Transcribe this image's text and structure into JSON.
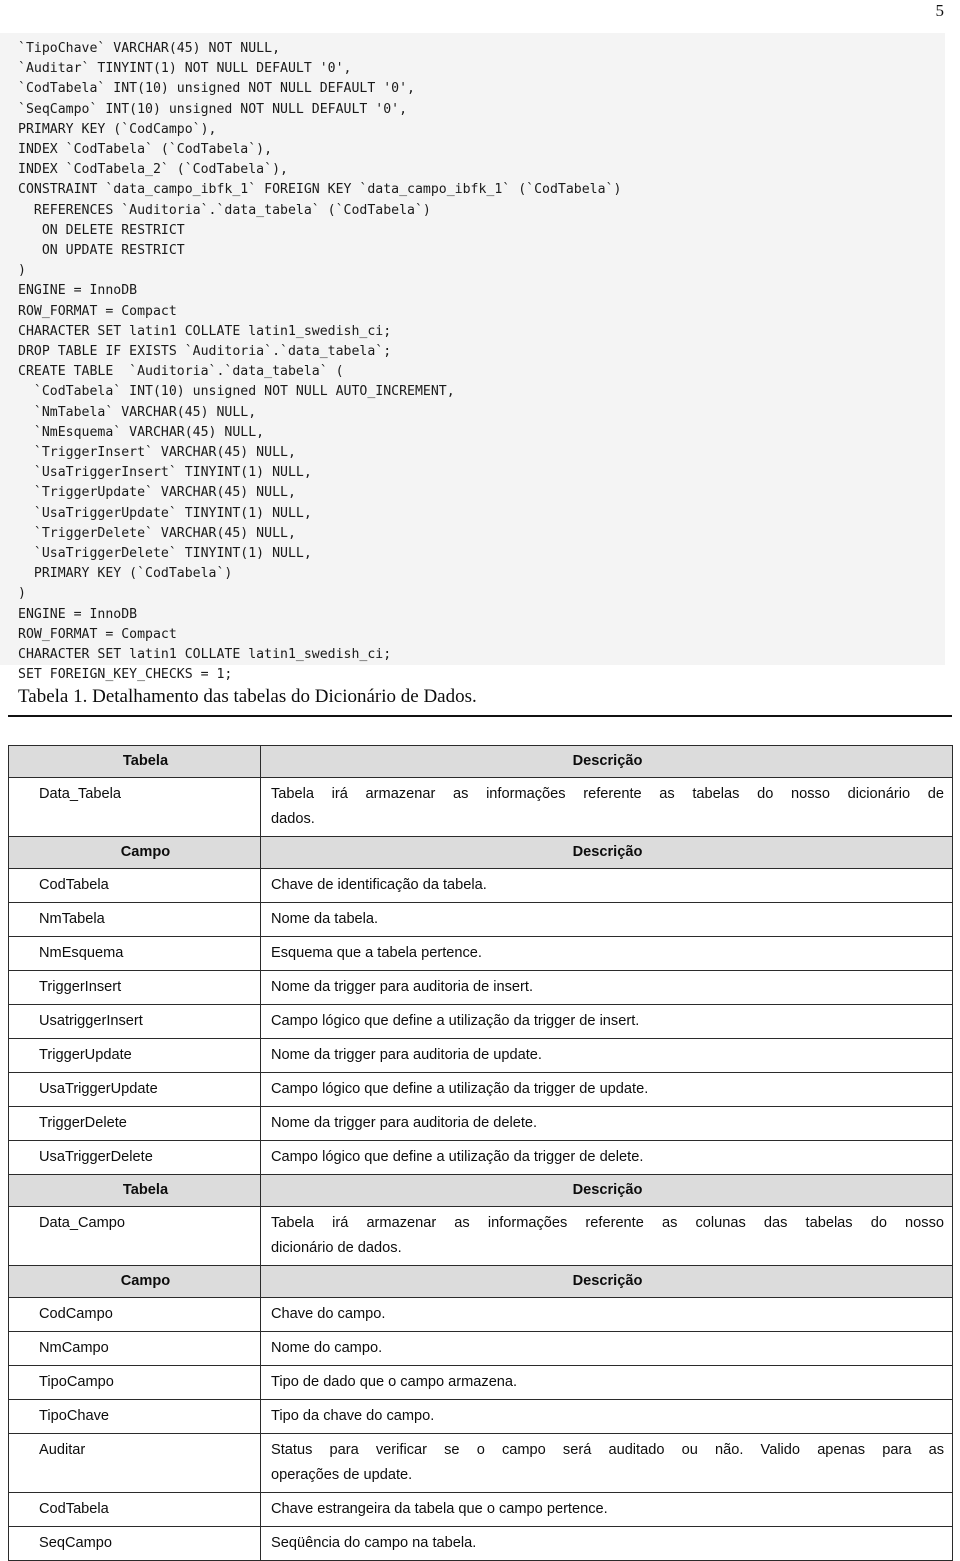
{
  "page": {
    "number": "5"
  },
  "code_block": {
    "language": "sql",
    "lines": [
      "`TipoChave` VARCHAR(45) NOT NULL,",
      "`Auditar` TINYINT(1) NOT NULL DEFAULT '0',",
      "`CodTabela` INT(10) unsigned NOT NULL DEFAULT '0',",
      "`SeqCampo` INT(10) unsigned NOT NULL DEFAULT '0',",
      "PRIMARY KEY (`CodCampo`),",
      "INDEX `CodTabela` (`CodTabela`),",
      "INDEX `CodTabela_2` (`CodTabela`),",
      "CONSTRAINT `data_campo_ibfk_1` FOREIGN KEY `data_campo_ibfk_1` (`CodTabela`)",
      "  REFERENCES `Auditoria`.`data_tabela` (`CodTabela`)",
      "   ON DELETE RESTRICT",
      "   ON UPDATE RESTRICT",
      ")",
      "ENGINE = InnoDB",
      "ROW_FORMAT = Compact",
      "CHARACTER SET latin1 COLLATE latin1_swedish_ci;",
      "",
      "DROP TABLE IF EXISTS `Auditoria`.`data_tabela`;",
      "CREATE TABLE  `Auditoria`.`data_tabela` (",
      "  `CodTabela` INT(10) unsigned NOT NULL AUTO_INCREMENT,",
      "  `NmTabela` VARCHAR(45) NULL,",
      "  `NmEsquema` VARCHAR(45) NULL,",
      "  `TriggerInsert` VARCHAR(45) NULL,",
      "  `UsaTriggerInsert` TINYINT(1) NULL,",
      "  `TriggerUpdate` VARCHAR(45) NULL,",
      "  `UsaTriggerUpdate` TINYINT(1) NULL,",
      "  `TriggerDelete` VARCHAR(45) NULL,",
      "  `UsaTriggerDelete` TINYINT(1) NULL,",
      "  PRIMARY KEY (`CodTabela`)",
      ")",
      "ENGINE = InnoDB",
      "ROW_FORMAT = Compact",
      "CHARACTER SET latin1 COLLATE latin1_swedish_ci;",
      "",
      "SET FOREIGN_KEY_CHECKS = 1;"
    ]
  },
  "caption": {
    "text": "Tabela 1. Detalhamento das tabelas do Dicionário de Dados."
  },
  "table": {
    "rows": [
      {
        "type": "header",
        "key": "Tabela",
        "value": "Descrição"
      },
      {
        "type": "data",
        "key": "Data_Tabela",
        "value": "Tabela irá armazenar as informações referente as tabelas do nosso dicionário de dados.",
        "line1": "Tabela irá armazenar as informações referente as tabelas do nosso dicionário de",
        "line2": "dados."
      },
      {
        "type": "header",
        "key": "Campo",
        "value": "Descrição"
      },
      {
        "type": "data",
        "key": "CodTabela",
        "value": "Chave de identificação da tabela."
      },
      {
        "type": "data",
        "key": "NmTabela",
        "value": "Nome da tabela."
      },
      {
        "type": "data",
        "key": "NmEsquema",
        "value": "Esquema que a tabela pertence."
      },
      {
        "type": "data",
        "key": "TriggerInsert",
        "value": "Nome da trigger para auditoria de insert."
      },
      {
        "type": "data",
        "key": "UsatriggerInsert",
        "value": "Campo lógico que define a utilização da trigger de insert."
      },
      {
        "type": "data",
        "key": "TriggerUpdate",
        "value": "Nome da trigger para auditoria de update."
      },
      {
        "type": "data",
        "key": "UsaTriggerUpdate",
        "value": "Campo lógico que define a utilização da trigger de update."
      },
      {
        "type": "data",
        "key": "TriggerDelete",
        "value": "Nome da trigger para auditoria de delete."
      },
      {
        "type": "data",
        "key": "UsaTriggerDelete",
        "value": "Campo lógico que define a utilização da trigger de delete."
      },
      {
        "type": "header",
        "key": "Tabela",
        "value": "Descrição"
      },
      {
        "type": "data",
        "key": "Data_Campo",
        "value": "Tabela irá armazenar as informações referente as colunas das tabelas do nosso dicionário de dados.",
        "line1": "Tabela irá armazenar as informações referente as colunas das tabelas do nosso",
        "line2": "dicionário de dados."
      },
      {
        "type": "header",
        "key": "Campo",
        "value": "Descrição"
      },
      {
        "type": "data",
        "key": "CodCampo",
        "value": "Chave do campo."
      },
      {
        "type": "data",
        "key": "NmCampo",
        "value": "Nome do campo."
      },
      {
        "type": "data",
        "key": "TipoCampo",
        "value": "Tipo de dado que o campo armazena."
      },
      {
        "type": "data",
        "key": "TipoChave",
        "value": "Tipo da chave do campo."
      },
      {
        "type": "data",
        "key": "Auditar",
        "value": "Status para verificar se o campo será auditado ou não. Valido apenas para as operações de update.",
        "line1": "Status para verificar se o campo será auditado ou não. Valido apenas para as",
        "line2": "operações de update."
      },
      {
        "type": "data",
        "key": "CodTabela",
        "value": "Chave estrangeira da tabela que o campo pertence."
      },
      {
        "type": "data",
        "key": "SeqCampo",
        "value": "Seqüência do campo na tabela."
      }
    ]
  },
  "colors": {
    "code_background": "#f4f4f4",
    "header_background": "#dcdcdc",
    "border": "#2b2b2b",
    "text": "#0d0d0d"
  }
}
